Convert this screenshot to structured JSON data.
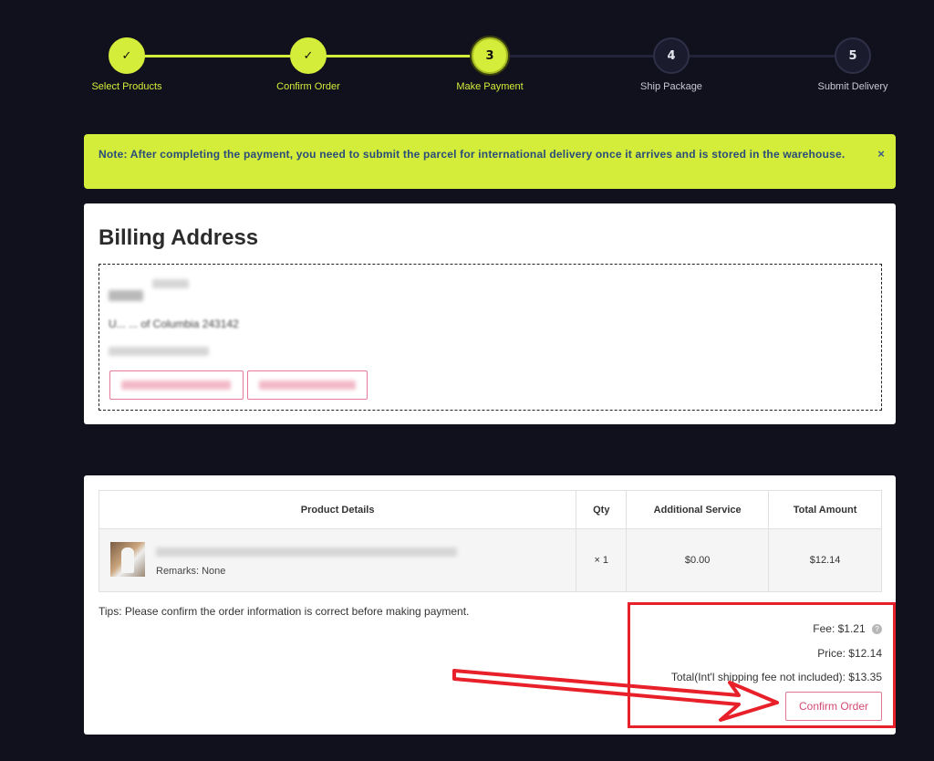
{
  "stepper": {
    "steps": [
      {
        "marker": "✓",
        "label": "Select Products"
      },
      {
        "marker": "✓",
        "label": "Confirm Order"
      },
      {
        "marker": "3",
        "label": "Make Payment"
      },
      {
        "marker": "4",
        "label": "Ship Package"
      },
      {
        "marker": "5",
        "label": "Submit Delivery"
      }
    ],
    "current_step": 3
  },
  "note": {
    "text": "Note: After completing the payment, you need to submit the parcel for international delivery once it arrives and is stored in the warehouse.",
    "close": "×"
  },
  "billing": {
    "title": "Billing Address",
    "address_line": "U... ... of Columbia 243142"
  },
  "table": {
    "headers": [
      "Product Details",
      "Qty",
      "Additional Service",
      "Total Amount"
    ],
    "rows": [
      {
        "remarks": "Remarks: None",
        "qty": "× 1",
        "service": "$0.00",
        "total": "$12.14"
      }
    ]
  },
  "tips": "Tips: Please confirm the order information is correct before making payment.",
  "summary": {
    "fee": "Fee: $1.21",
    "fee_info": "?",
    "price": "Price: $12.14",
    "total": "Total(Int'l shipping fee not included): $13.35"
  },
  "confirm_button": "Confirm Order",
  "colors": {
    "accent": "#d4ec3a",
    "background": "#11111d",
    "button_text": "#d44a72",
    "annotation": "#e8202a"
  }
}
